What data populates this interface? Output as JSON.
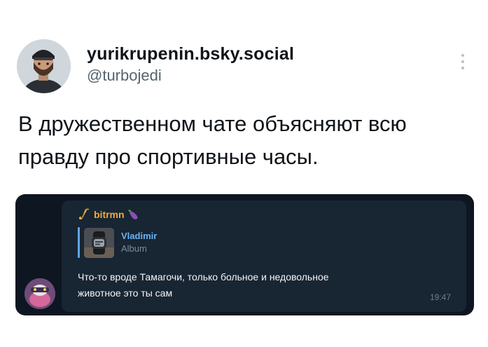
{
  "post": {
    "display_name": "yurikrupenin.bsky.social",
    "handle": "@turbojedi",
    "text_line1": "В дружественном чате объясняют всю",
    "text_line2": "правду про спортивные часы."
  },
  "telegram": {
    "sender_name": "bitrmn",
    "reply": {
      "name": "Vladimir",
      "subtitle": "Album"
    },
    "message_line1": "Что-то вроде Тамагочи, только больное и недовольное",
    "message_line2": "животное это ты сам",
    "time": "19:47"
  },
  "colors": {
    "name_text": "#0f1419",
    "handle_text": "#536471",
    "tg_background": "#0e1621",
    "tg_bubble": "#182533",
    "tg_sender": "#f2a93b",
    "tg_reply_accent": "#6ab3f3",
    "tg_message_text": "#f5f5f5",
    "tg_time": "#6d7f8f"
  },
  "icons": {
    "more": "more-vertical-icon",
    "sender_emoji_left": "saxophone-icon",
    "sender_emoji_right": "eggplant-icon"
  }
}
